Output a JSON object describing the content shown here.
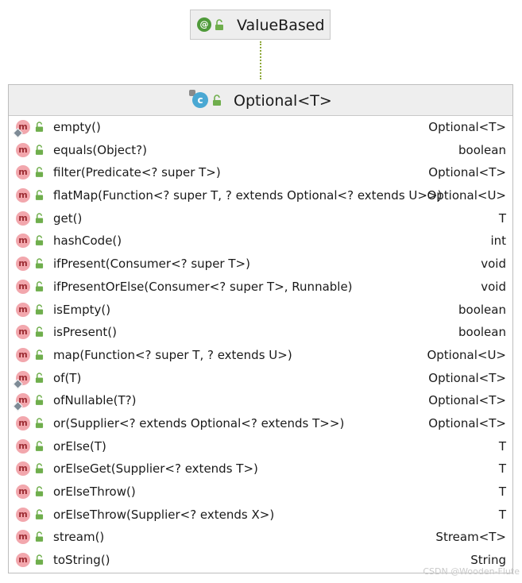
{
  "annotation": {
    "icon": "annotation-icon",
    "icon_glyph": "@",
    "title": "ValueBased",
    "color": "#4f9a3a"
  },
  "class": {
    "icon": "class-icon",
    "icon_glyph": "c",
    "title": "Optional<T>",
    "color": "#4aa8d3"
  },
  "method_icon": {
    "glyph": "m",
    "color": "#f2a7ad"
  },
  "members": [
    {
      "name": "empty()",
      "type": "Optional<T>",
      "static": true
    },
    {
      "name": "equals(Object?)",
      "type": "boolean",
      "static": false
    },
    {
      "name": "filter(Predicate<? super T>)",
      "type": "Optional<T>",
      "static": false
    },
    {
      "name": "flatMap(Function<? super T, ? extends Optional<? extends U>>)",
      "type": "Optional<U>",
      "static": false
    },
    {
      "name": "get()",
      "type": "T",
      "static": false
    },
    {
      "name": "hashCode()",
      "type": "int",
      "static": false
    },
    {
      "name": "ifPresent(Consumer<? super T>)",
      "type": "void",
      "static": false
    },
    {
      "name": "ifPresentOrElse(Consumer<? super T>, Runnable)",
      "type": "void",
      "static": false
    },
    {
      "name": "isEmpty()",
      "type": "boolean",
      "static": false
    },
    {
      "name": "isPresent()",
      "type": "boolean",
      "static": false
    },
    {
      "name": "map(Function<? super T, ? extends U>)",
      "type": "Optional<U>",
      "static": false
    },
    {
      "name": "of(T)",
      "type": "Optional<T>",
      "static": true
    },
    {
      "name": "ofNullable(T?)",
      "type": "Optional<T>",
      "static": true
    },
    {
      "name": "or(Supplier<? extends Optional<? extends T>>)",
      "type": "Optional<T>",
      "static": false
    },
    {
      "name": "orElse(T)",
      "type": "T",
      "static": false
    },
    {
      "name": "orElseGet(Supplier<? extends T>)",
      "type": "T",
      "static": false
    },
    {
      "name": "orElseThrow()",
      "type": "T",
      "static": false
    },
    {
      "name": "orElseThrow(Supplier<? extends X>)",
      "type": "T",
      "static": false
    },
    {
      "name": "stream()",
      "type": "Stream<T>",
      "static": false
    },
    {
      "name": "toString()",
      "type": "String",
      "static": false
    }
  ],
  "watermark": "CSDN @Wooden-Flute"
}
